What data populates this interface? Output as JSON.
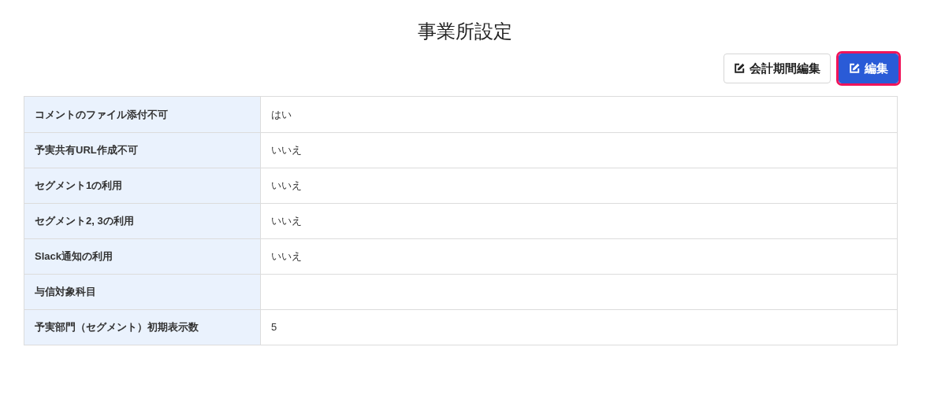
{
  "title": "事業所設定",
  "buttons": [
    {
      "kind": "outline",
      "label": "会計期間編集",
      "focused": false
    },
    {
      "kind": "primary",
      "label": "編集",
      "focused": true
    }
  ],
  "settings": [
    {
      "label": "コメントのファイル添付不可",
      "value": "はい"
    },
    {
      "label": "予実共有URL作成不可",
      "value": "いいえ"
    },
    {
      "label": "セグメント1の利用",
      "value": "いいえ"
    },
    {
      "label": "セグメント2, 3の利用",
      "value": "いいえ"
    },
    {
      "label": "Slack通知の利用",
      "value": "いいえ"
    },
    {
      "label": "与信対象科目"
    },
    {
      "label": "予実部門（セグメント）初期表示数",
      "value": "5"
    }
  ]
}
